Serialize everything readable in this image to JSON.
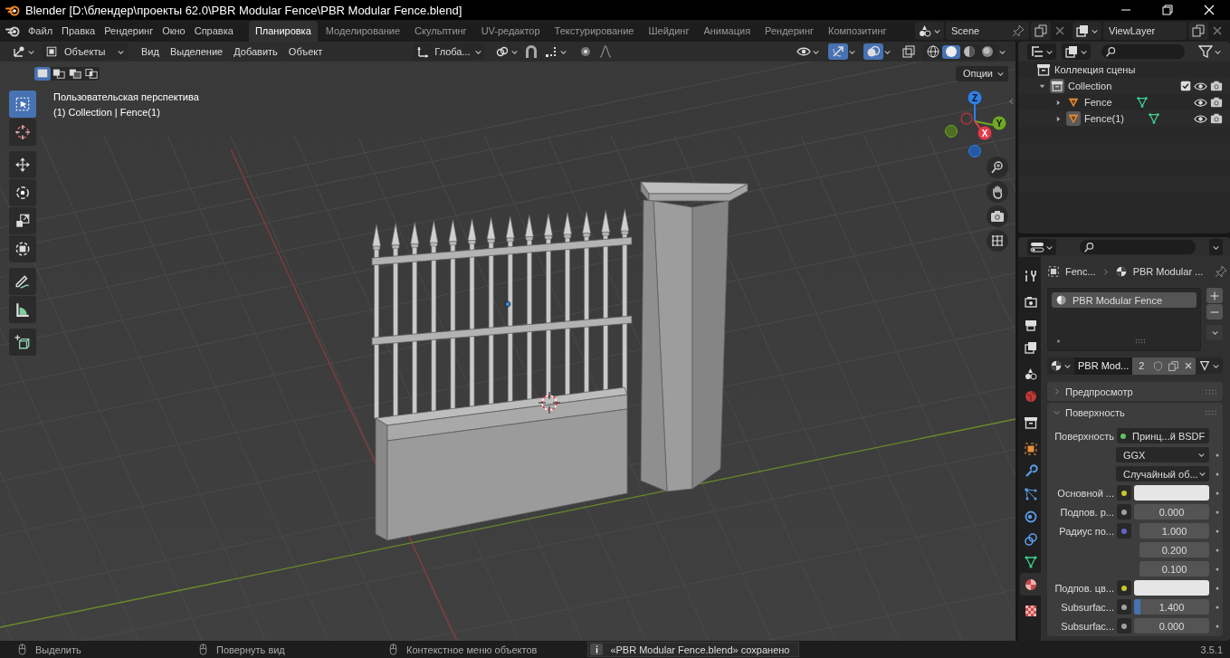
{
  "window": {
    "title": "Blender [D:\\блендер\\проекты 62.0\\PBR Modular Fence\\PBR Modular Fence.blend]"
  },
  "menu": [
    "Файл",
    "Правка",
    "Рендеринг",
    "Окно",
    "Справка"
  ],
  "workspaces": [
    {
      "label": "Планировка",
      "selected": true
    },
    {
      "label": "Моделирование",
      "selected": false
    },
    {
      "label": "Скульптинг",
      "selected": false
    },
    {
      "label": "UV-редактор",
      "selected": false
    },
    {
      "label": "Текстурирование",
      "selected": false
    },
    {
      "label": "Шейдинг",
      "selected": false
    },
    {
      "label": "Анимация",
      "selected": false
    },
    {
      "label": "Рендеринг",
      "selected": false
    },
    {
      "label": "Композитинг",
      "selected": false
    }
  ],
  "scene": {
    "name": "Scene"
  },
  "view_layer": {
    "name": "ViewLayer"
  },
  "viewport": {
    "mode": "Объекты",
    "menu": [
      "Вид",
      "Выделение",
      "Добавить",
      "Объект"
    ],
    "orientation": "Глоба...",
    "show_gizmos": true,
    "show_overlays": true,
    "select_modes": [
      {
        "kind": "set",
        "selected": true
      },
      {
        "kind": "extend",
        "selected": false
      },
      {
        "kind": "subtract",
        "selected": false
      },
      {
        "kind": "intersect",
        "selected": false
      }
    ],
    "shading_modes": [
      {
        "kind": "wireframe",
        "selected": false
      },
      {
        "kind": "solid",
        "selected": true
      },
      {
        "kind": "material",
        "selected": false
      },
      {
        "kind": "rendered",
        "selected": false
      }
    ],
    "options": "Опции",
    "view_name": "Пользовательская перспектива",
    "object_info": "(1) Collection | Fence(1)",
    "axes": [
      "X",
      "Y",
      "Z"
    ],
    "tools": [
      {
        "kind": "select",
        "selected": true
      },
      {
        "kind": "cursor",
        "selected": false
      },
      {
        "kind": "move",
        "selected": false
      },
      {
        "kind": "rotate",
        "selected": false
      },
      {
        "kind": "scale",
        "selected": false
      },
      {
        "kind": "transform",
        "selected": false
      },
      {
        "kind": "annotate",
        "selected": false
      },
      {
        "kind": "measure",
        "selected": false
      },
      {
        "kind": "add",
        "selected": false
      }
    ]
  },
  "outliner": {
    "title": "Коллекция сцены",
    "items": [
      {
        "kind": "collection",
        "name": "Collection",
        "expanded": true,
        "checked": true,
        "children": [
          {
            "kind": "mesh",
            "name": "Fence",
            "expanded": false,
            "selected": false
          },
          {
            "kind": "mesh",
            "name": "Fence(1)",
            "expanded": false,
            "selected": true
          }
        ]
      }
    ]
  },
  "properties": {
    "tabs": [
      {
        "kind": "tool",
        "selected": false
      },
      {
        "kind": "render",
        "selected": false
      },
      {
        "kind": "output",
        "selected": false
      },
      {
        "kind": "view",
        "selected": false
      },
      {
        "kind": "scene",
        "selected": false
      },
      {
        "kind": "world",
        "selected": false
      },
      {
        "kind": "collection",
        "selected": false
      },
      {
        "kind": "object",
        "selected": false
      },
      {
        "kind": "modifiers",
        "selected": false
      },
      {
        "kind": "particles",
        "selected": false
      },
      {
        "kind": "physics",
        "selected": false
      },
      {
        "kind": "constraints",
        "selected": false
      },
      {
        "kind": "data",
        "selected": false
      },
      {
        "kind": "material",
        "selected": true
      },
      {
        "kind": "texture",
        "selected": false
      }
    ],
    "breadcrumb": [
      "Fenc...",
      "PBR Modular ..."
    ],
    "material_slots": [
      {
        "name": "PBR Modular Fence",
        "selected": true
      }
    ],
    "material": {
      "name": "PBR Mod...",
      "users": "2"
    },
    "panels": [
      {
        "title": "Предпросмотр",
        "expanded": false
      },
      {
        "title": "Поверхность",
        "expanded": true,
        "rows": [
          {
            "kind": "link",
            "label": "Поверхность",
            "value": "Принц...й BSDF",
            "color": "#5fc15f"
          },
          {
            "kind": "dropdown",
            "value": "GGX"
          },
          {
            "kind": "dropdown",
            "value": "Случайный об..."
          },
          {
            "kind": "color",
            "label": "Основной ...",
            "color": "#c7c729"
          },
          {
            "kind": "number",
            "label": "Подпов. р...",
            "value": "0.000",
            "color": "#a1a1a1"
          },
          {
            "kind": "vector",
            "label": "Радиус по...",
            "values": [
              "1.000",
              "0.200",
              "0.100"
            ],
            "color": "#6363c7"
          },
          {
            "kind": "color",
            "label": "Подпов. цв...",
            "color": "#c7c729"
          },
          {
            "kind": "slider",
            "label": "Subsurfac...",
            "value": "1.400",
            "level": 0.09,
            "color": "#a1a1a1"
          },
          {
            "kind": "number",
            "label": "Subsurfac...",
            "value": "0.000",
            "color": "#a1a1a1"
          }
        ]
      }
    ]
  },
  "status_bar": {
    "hints": [
      "Выделить",
      "Повернуть вид",
      "Контекстное меню объектов"
    ],
    "message": "«PBR Modular Fence.blend» сохранено",
    "version": "3.5.1"
  }
}
